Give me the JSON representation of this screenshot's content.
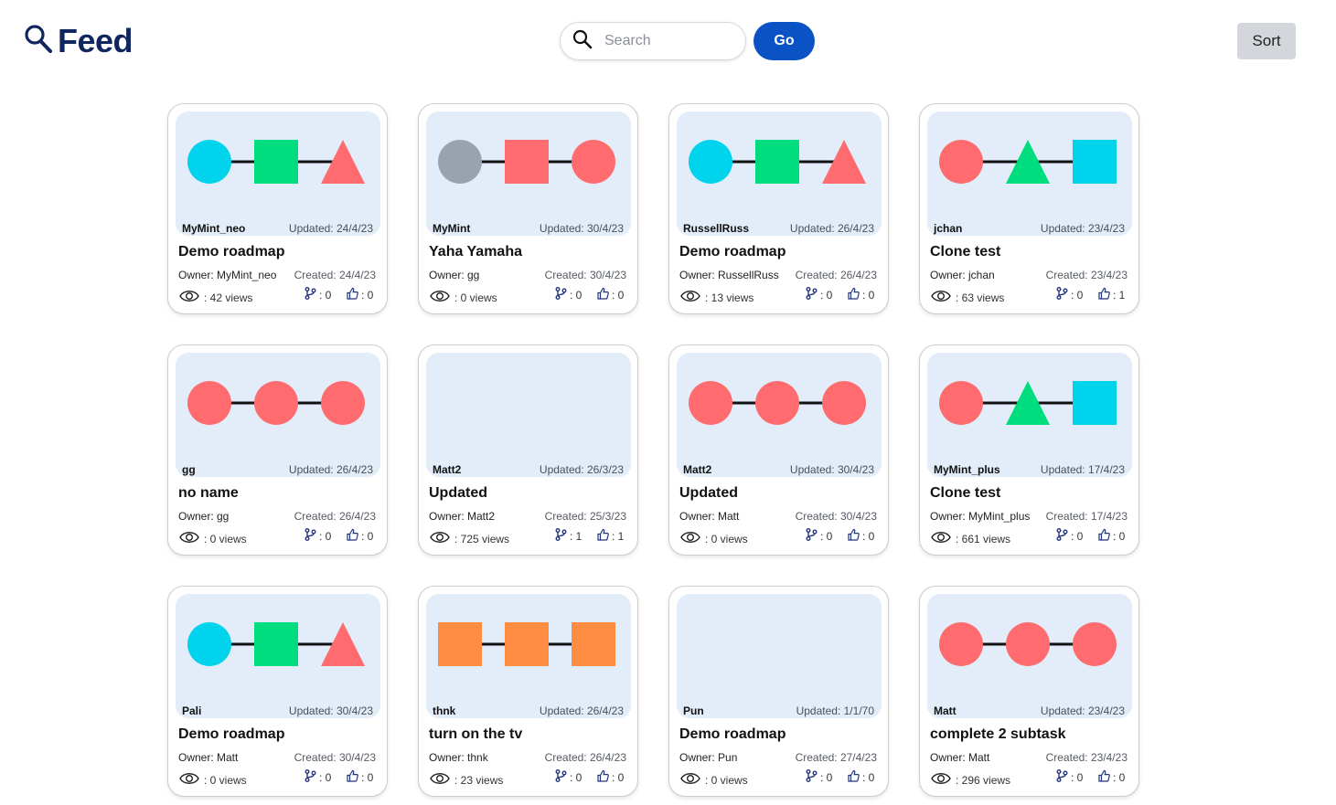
{
  "header": {
    "logo_text": "Feed",
    "logo_icon": "search-icon",
    "search_placeholder": "Search",
    "search_value": "",
    "go_label": "Go",
    "sort_label": "Sort"
  },
  "colors": {
    "brand": "#10265e",
    "go_button": "#0b52c5",
    "thumb_bg": "#e3edf9",
    "cyan": "#00d4ec",
    "green": "#00dd7e",
    "red": "#ff6b6e",
    "gray": "#9aa2ad",
    "orange": "#ff8c42"
  },
  "cards": [
    {
      "user": "MyMint_neo",
      "updated": "Updated: 24/4/23",
      "title": "Demo roadmap",
      "owner": "Owner: MyMint_neo",
      "created": "Created: 24/4/23",
      "views": ": 42 views",
      "forks": ": 0",
      "likes": ": 0",
      "nodes": [
        {
          "shape": "circle",
          "color": "cyan"
        },
        {
          "shape": "square",
          "color": "green"
        },
        {
          "shape": "triangle",
          "color": "red"
        }
      ]
    },
    {
      "user": "MyMint",
      "updated": "Updated: 30/4/23",
      "title": "Yaha Yamaha",
      "owner": "Owner: gg",
      "created": "Created: 30/4/23",
      "views": ": 0 views",
      "forks": ": 0",
      "likes": ": 0",
      "nodes": [
        {
          "shape": "circle",
          "color": "gray"
        },
        {
          "shape": "square",
          "color": "red"
        },
        {
          "shape": "circle",
          "color": "red"
        }
      ]
    },
    {
      "user": "RussellRuss",
      "updated": "Updated: 26/4/23",
      "title": "Demo roadmap",
      "owner": "Owner: RussellRuss",
      "created": "Created: 26/4/23",
      "views": ": 13 views",
      "forks": ": 0",
      "likes": ": 0",
      "nodes": [
        {
          "shape": "circle",
          "color": "cyan"
        },
        {
          "shape": "square",
          "color": "green"
        },
        {
          "shape": "triangle",
          "color": "red"
        }
      ]
    },
    {
      "user": "jchan",
      "updated": "Updated: 23/4/23",
      "title": "Clone test",
      "owner": "Owner: jchan",
      "created": "Created: 23/4/23",
      "views": ": 63 views",
      "forks": ": 0",
      "likes": ": 1",
      "nodes": [
        {
          "shape": "circle",
          "color": "red"
        },
        {
          "shape": "triangle",
          "color": "green"
        },
        {
          "shape": "square",
          "color": "cyan"
        }
      ]
    },
    {
      "user": "gg",
      "updated": "Updated: 26/4/23",
      "title": "no name",
      "owner": "Owner: gg",
      "created": "Created: 26/4/23",
      "views": ": 0 views",
      "forks": ": 0",
      "likes": ": 0",
      "nodes": [
        {
          "shape": "circle",
          "color": "red"
        },
        {
          "shape": "circle",
          "color": "red"
        },
        {
          "shape": "circle",
          "color": "red"
        }
      ]
    },
    {
      "user": "Matt2",
      "updated": "Updated: 26/3/23",
      "title": "Updated",
      "owner": "Owner: Matt2",
      "created": "Created: 25/3/23",
      "views": ": 725 views",
      "forks": ": 1",
      "likes": ": 1",
      "nodes": []
    },
    {
      "user": "Matt2",
      "updated": "Updated: 30/4/23",
      "title": "Updated",
      "owner": "Owner: Matt",
      "created": "Created: 30/4/23",
      "views": ": 0 views",
      "forks": ": 0",
      "likes": ": 0",
      "nodes": [
        {
          "shape": "circle",
          "color": "red"
        },
        {
          "shape": "circle",
          "color": "red"
        },
        {
          "shape": "circle",
          "color": "red"
        }
      ]
    },
    {
      "user": "MyMint_plus",
      "updated": "Updated: 17/4/23",
      "title": "Clone test",
      "owner": "Owner: MyMint_plus",
      "created": "Created: 17/4/23",
      "views": ": 661 views",
      "forks": ": 0",
      "likes": ": 0",
      "nodes": [
        {
          "shape": "circle",
          "color": "red"
        },
        {
          "shape": "triangle",
          "color": "green"
        },
        {
          "shape": "square",
          "color": "cyan"
        }
      ]
    },
    {
      "user": "Pali",
      "updated": "Updated: 30/4/23",
      "title": "Demo roadmap",
      "owner": "Owner: Matt",
      "created": "Created: 30/4/23",
      "views": ": 0 views",
      "forks": ": 0",
      "likes": ": 0",
      "nodes": [
        {
          "shape": "circle",
          "color": "cyan"
        },
        {
          "shape": "square",
          "color": "green"
        },
        {
          "shape": "triangle",
          "color": "red"
        }
      ]
    },
    {
      "user": "thnk",
      "updated": "Updated: 26/4/23",
      "title": "turn on the tv",
      "owner": "Owner: thnk",
      "created": "Created: 26/4/23",
      "views": ": 23 views",
      "forks": ": 0",
      "likes": ": 0",
      "nodes": [
        {
          "shape": "square",
          "color": "orange"
        },
        {
          "shape": "square",
          "color": "orange"
        },
        {
          "shape": "square",
          "color": "orange"
        }
      ]
    },
    {
      "user": "Pun",
      "updated": "Updated: 1/1/70",
      "title": "Demo roadmap",
      "owner": "Owner: Pun",
      "created": "Created: 27/4/23",
      "views": ": 0 views",
      "forks": ": 0",
      "likes": ": 0",
      "nodes": []
    },
    {
      "user": "Matt",
      "updated": "Updated: 23/4/23",
      "title": "complete 2 subtask",
      "owner": "Owner: Matt",
      "created": "Created: 23/4/23",
      "views": ": 296 views",
      "forks": ": 0",
      "likes": ": 0",
      "nodes": [
        {
          "shape": "circle",
          "color": "red"
        },
        {
          "shape": "circle",
          "color": "red"
        },
        {
          "shape": "circle",
          "color": "red"
        }
      ]
    }
  ]
}
